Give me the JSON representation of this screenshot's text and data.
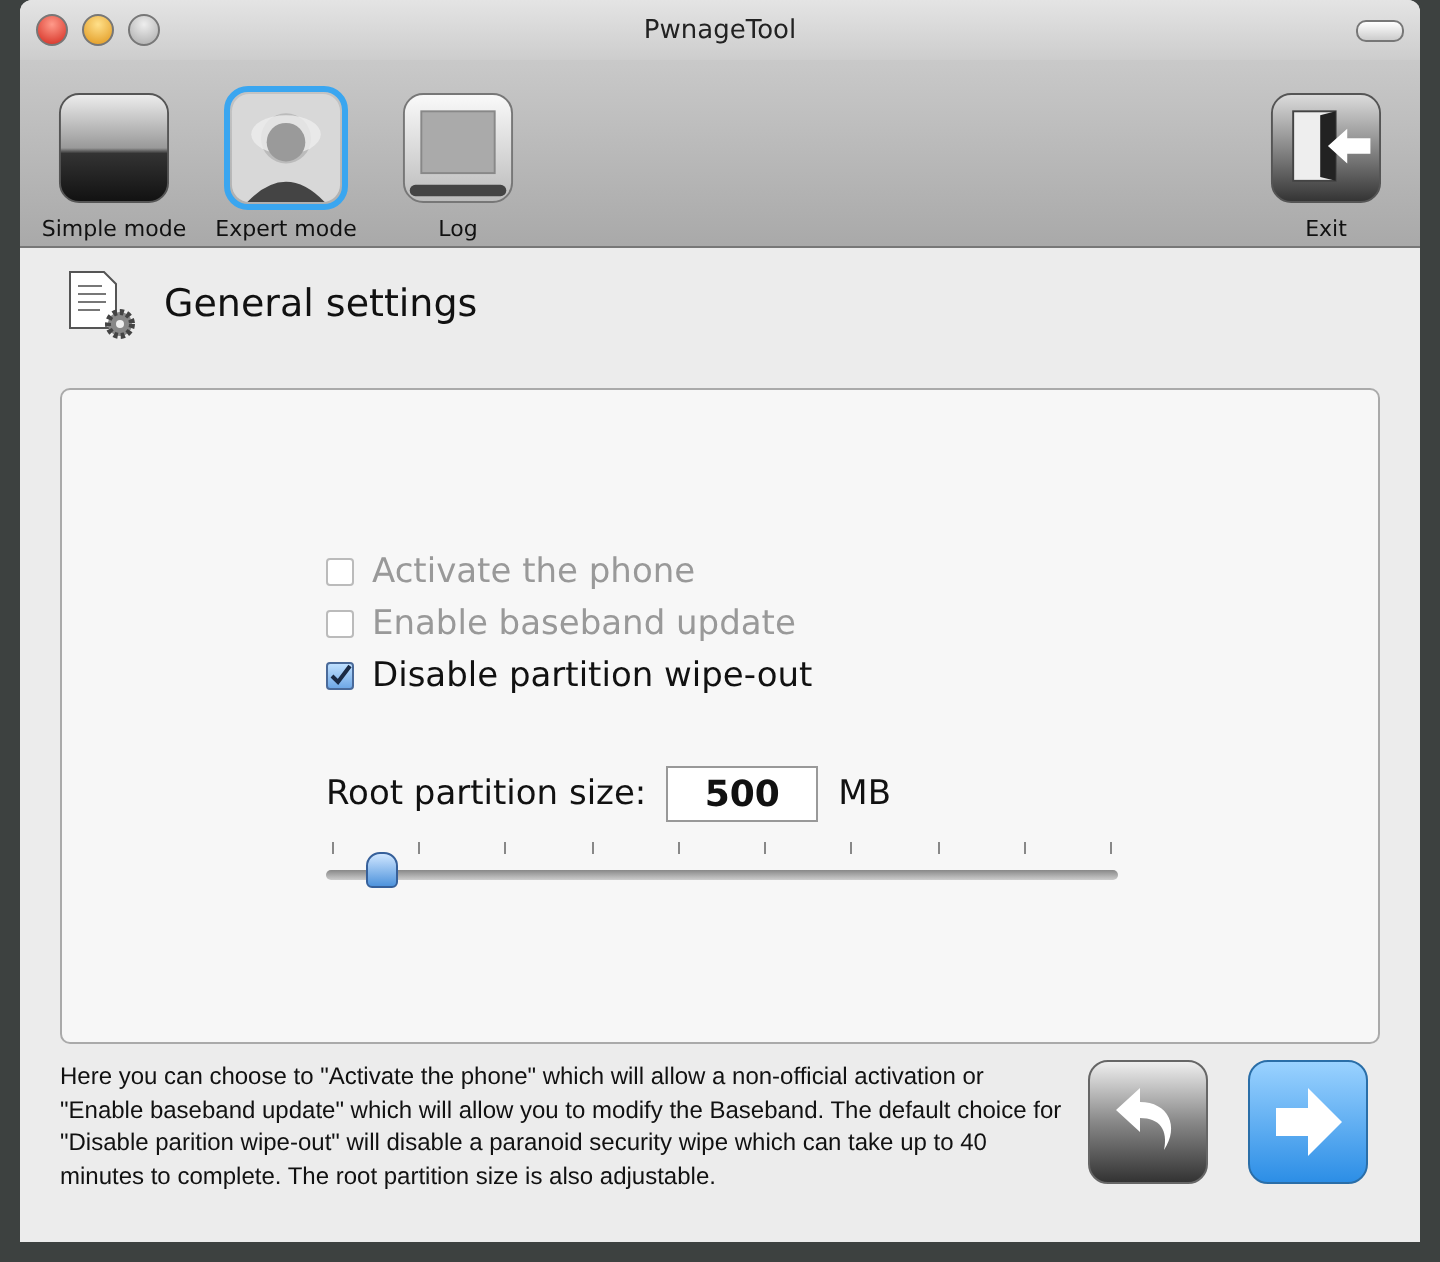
{
  "window": {
    "title": "PwnageTool"
  },
  "toolbar": {
    "items": [
      {
        "kind": "simple",
        "label": "Simple mode",
        "selected": false
      },
      {
        "kind": "expert",
        "label": "Expert mode",
        "selected": true
      },
      {
        "kind": "log",
        "label": "Log",
        "selected": false
      }
    ],
    "exit": {
      "kind": "exit",
      "label": "Exit"
    }
  },
  "section": {
    "title": "General settings"
  },
  "options": [
    {
      "label": "Activate the phone",
      "checked": false,
      "disabled": true
    },
    {
      "label": "Enable baseband update",
      "checked": false,
      "disabled": true
    },
    {
      "label": "Disable partition wipe-out",
      "checked": true,
      "disabled": false
    }
  ],
  "partition": {
    "label": "Root partition size:",
    "value": "500",
    "unit": "MB",
    "level": 0.05
  },
  "help": "Here you can choose to \"Activate the phone\" which will allow a non-official activation or \"Enable baseband update\" which will allow you to modify the Baseband. The default choice for \"Disable parition wipe-out\" will disable a paranoid security wipe which can take up to 40 minutes to complete. The root partition size is also adjustable."
}
